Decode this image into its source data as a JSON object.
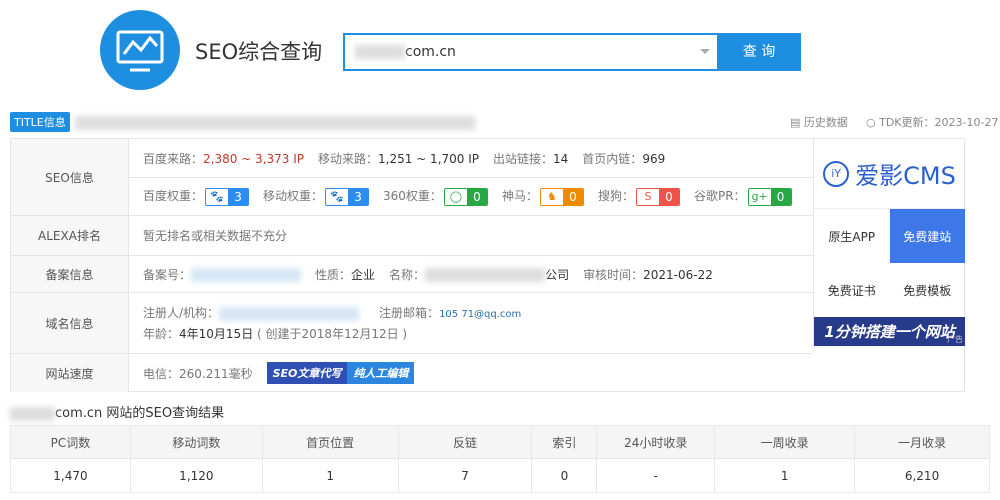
{
  "header": {
    "title": "SEO综合查询",
    "search_value_suffix": "com.cn",
    "search_button": "查 询",
    "logo_icon": "monitor-chart-icon"
  },
  "title_bar": {
    "badge": "TITLE信息",
    "history": "历史数据",
    "tdk_update": "TDK更新：2023-10-27"
  },
  "seo": {
    "label": "SEO信息",
    "baidu_traffic_label": "百度来路：",
    "baidu_traffic": "2,380 ~ 3,373 IP",
    "mobile_traffic_label": "移动来路：",
    "mobile_traffic": "1,251 ~ 1,700 IP",
    "outlinks_label": "出站链接：",
    "outlinks": "14",
    "home_inlinks_label": "首页内链：",
    "home_inlinks": "969",
    "weights": [
      {
        "label": "百度权重：",
        "value": "3",
        "color": "#2d8cf0",
        "icon": "paw-icon"
      },
      {
        "label": "移动权重：",
        "value": "3",
        "color": "#2d8cf0",
        "icon": "paw-icon"
      },
      {
        "label": "360权重：",
        "value": "0",
        "color": "#27a844",
        "icon": "360-icon"
      },
      {
        "label": "神马：",
        "value": "0",
        "color": "#f08a00",
        "icon": "shenma-icon"
      },
      {
        "label": "搜狗：",
        "value": "0",
        "color": "#f0524a",
        "icon": "sogou-icon"
      },
      {
        "label": "谷歌PR：",
        "value": "0",
        "color": "#27a844",
        "icon": "google-plus-icon"
      }
    ]
  },
  "alexa": {
    "label": "ALEXA排名",
    "value": "暂无排名或相关数据不充分"
  },
  "icp": {
    "label": "备案信息",
    "no_label": "备案号：",
    "type_label": "性质：",
    "type": "企业",
    "name_label": "名称：",
    "name_suffix": "公司",
    "audit_label": "审核时间：",
    "audit": "2021-06-22"
  },
  "domain": {
    "label": "域名信息",
    "registrant_label": "注册人/机构：",
    "email_label": "注册邮箱：",
    "email": "105     71@qq.com",
    "age_label": "年龄：",
    "age": "4年10月15日",
    "created": "( 创建于2018年12月12日 )"
  },
  "speed": {
    "label": "网站速度",
    "value": "电信：260.211毫秒",
    "banner_a": "SEO文章代写",
    "banner_b": "纯人工编辑"
  },
  "ad": {
    "brand": "爱影CMS",
    "items": [
      "原生APP",
      "免费建站",
      "免费证书",
      "免费模板"
    ],
    "banner": "1分钟搭建一个网站",
    "tag": "广告"
  },
  "results": {
    "title_suffix": "com.cn 网站的SEO查询结果",
    "headers": [
      "PC词数",
      "移动词数",
      "首页位置",
      "反链",
      "索引",
      "24小时收录",
      "一周收录",
      "一月收录"
    ],
    "values": [
      "1,470",
      "1,120",
      "1",
      "7",
      "0",
      "-",
      "1",
      "6,210"
    ]
  }
}
